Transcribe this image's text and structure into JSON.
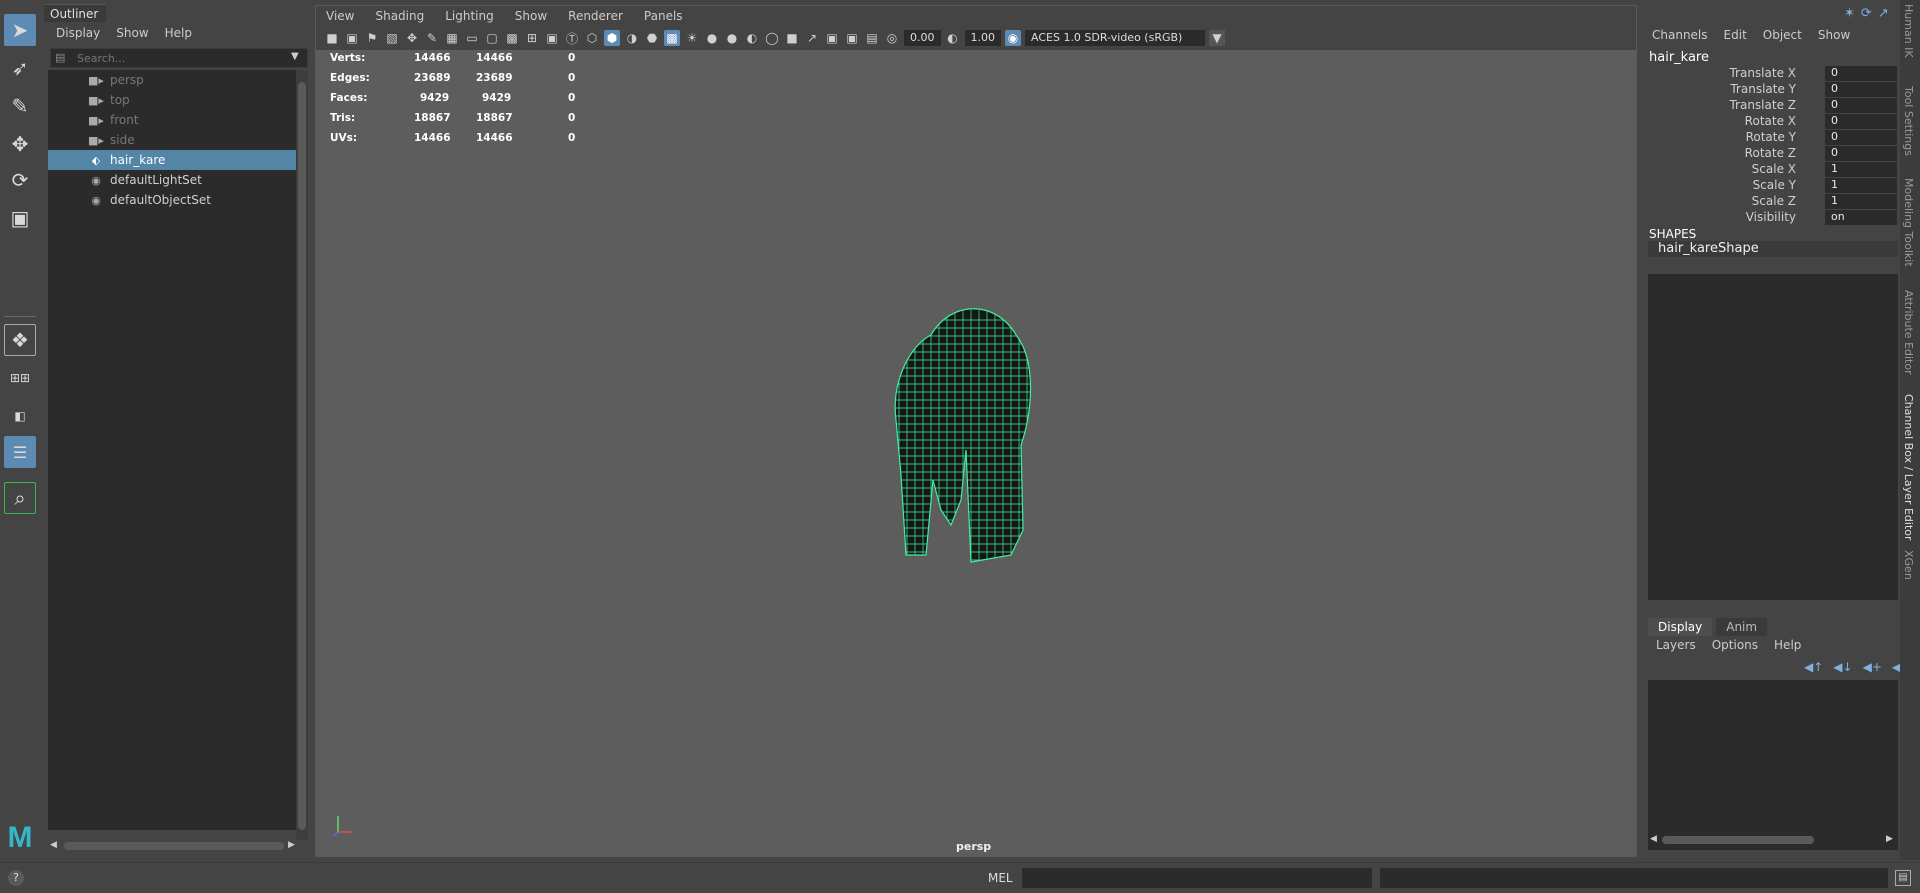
{
  "toolbox": {
    "tools": [
      "select-tool-icon",
      "lasso-tool-icon",
      "paint-select-tool-icon",
      "move-tool-icon",
      "rotate-tool-icon",
      "scale-tool-icon"
    ]
  },
  "outliner": {
    "tab": "Outliner",
    "menu": [
      "Display",
      "Show",
      "Help"
    ],
    "search_placeholder": "Search...",
    "items": [
      {
        "label": "persp",
        "icon": "camera-icon",
        "dim": true
      },
      {
        "label": "top",
        "icon": "camera-icon",
        "dim": true
      },
      {
        "label": "front",
        "icon": "camera-icon",
        "dim": true
      },
      {
        "label": "side",
        "icon": "camera-icon",
        "dim": true
      },
      {
        "label": "hair_kare",
        "icon": "mesh-icon",
        "selected": true
      },
      {
        "label": "defaultLightSet",
        "icon": "set-icon"
      },
      {
        "label": "defaultObjectSet",
        "icon": "set-icon"
      }
    ]
  },
  "viewport": {
    "menu": [
      "View",
      "Shading",
      "Lighting",
      "Show",
      "Renderer",
      "Panels"
    ],
    "exposure": "0.00",
    "gamma": "1.00",
    "color_space": "ACES 1.0 SDR-video (sRGB)",
    "camera_label": "persp",
    "hud": [
      {
        "label": "Verts:",
        "a": "14466",
        "b": "14466",
        "c": "0"
      },
      {
        "label": "Edges:",
        "a": "23689",
        "b": "23689",
        "c": "0"
      },
      {
        "label": "Faces:",
        "a": "9429",
        "b": "9429",
        "c": "0"
      },
      {
        "label": "Tris:",
        "a": "18867",
        "b": "18867",
        "c": "0"
      },
      {
        "label": "UVs:",
        "a": "14466",
        "b": "14466",
        "c": "0"
      }
    ],
    "wire_color": "#3ef0a0"
  },
  "channel_box": {
    "menu": [
      "Channels",
      "Edit",
      "Object",
      "Show"
    ],
    "object_name": "hair_kare",
    "attributes": [
      {
        "label": "Translate X",
        "value": "0"
      },
      {
        "label": "Translate Y",
        "value": "0"
      },
      {
        "label": "Translate Z",
        "value": "0"
      },
      {
        "label": "Rotate X",
        "value": "0"
      },
      {
        "label": "Rotate Y",
        "value": "0"
      },
      {
        "label": "Rotate Z",
        "value": "0"
      },
      {
        "label": "Scale X",
        "value": "1"
      },
      {
        "label": "Scale Y",
        "value": "1"
      },
      {
        "label": "Scale Z",
        "value": "1"
      },
      {
        "label": "Visibility",
        "value": "on"
      }
    ],
    "shapes_header": "SHAPES",
    "shape_name": "hair_kareShape"
  },
  "layer_editor": {
    "tabs": [
      "Display",
      "Anim"
    ],
    "menu": [
      "Layers",
      "Options",
      "Help"
    ]
  },
  "side_tabs": [
    "Human IK",
    "Tool Settings",
    "Modeling Toolkit",
    "Attribute Editor",
    "Channel Box / Layer Editor",
    "XGen"
  ],
  "bottom": {
    "mel_label": "MEL"
  },
  "accent_color": "#5285a6"
}
